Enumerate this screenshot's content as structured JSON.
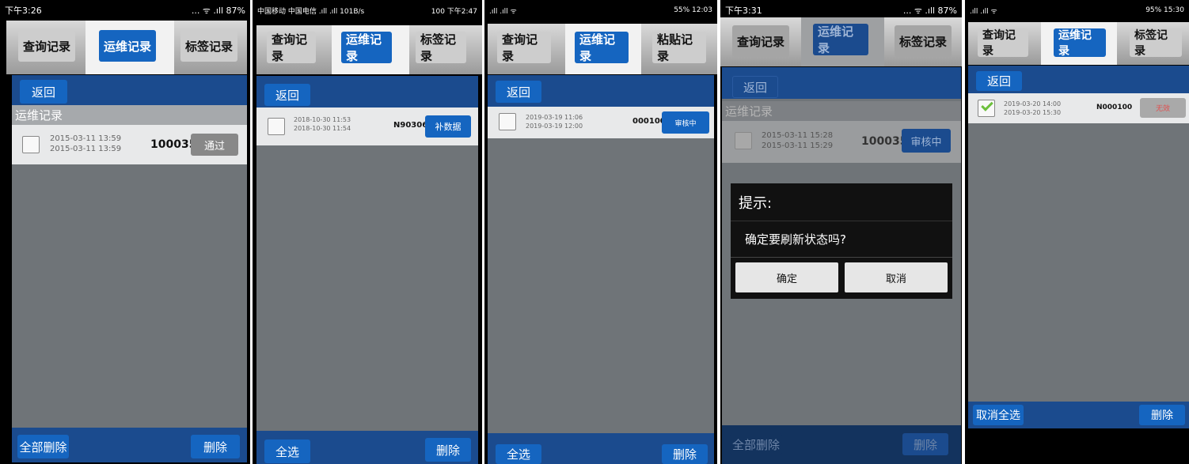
{
  "phones": [
    {
      "status_left": "下午3:26",
      "status_right": "... ᯤ .ıll 87%",
      "tabs": [
        "查询记录",
        "运维记录",
        "标签记录"
      ],
      "back": "返回",
      "section": "运维记录",
      "row": {
        "date1": "2015-03-11 13:59",
        "date2": "2015-03-11 13:59",
        "code": "100035",
        "status": "通过"
      },
      "bottom_left": "全部删除",
      "bottom_right": "删除"
    },
    {
      "status_left": "中国移动 中国电信 .ıll .ıll 101B/s",
      "status_right": "100 下午2:47",
      "tabs": [
        "查询记录",
        "运维记录",
        "标签记录"
      ],
      "back": "返回",
      "row": {
        "date1": "2018-10-30 11:53",
        "date2": "2018-10-30 11:54",
        "code": "N903069",
        "status": "补数据"
      },
      "bottom_left": "全选",
      "bottom_right": "删除"
    },
    {
      "status_left": ".ıll .ıll ᯤ",
      "status_right": "55% 12:03",
      "tabs": [
        "查询记录",
        "运维记录",
        "粘贴记录"
      ],
      "back": "返回",
      "row": {
        "date1": "2019-03-19 11:06",
        "date2": "2019-03-19 12:00",
        "code": "000100",
        "status": "审核中"
      },
      "bottom_left": "全选",
      "bottom_right": "删除"
    },
    {
      "status_left": "下午3:31",
      "status_right": "... ᯤ .ıll 87%",
      "tabs": [
        "查询记录",
        "运维记录",
        "标签记录"
      ],
      "back": "返回",
      "section": "运维记录",
      "row": {
        "date1": "2015-03-11 15:28",
        "date2": "2015-03-11 15:29",
        "code": "100035",
        "status": "审核中"
      },
      "dialog": {
        "title": "提示:",
        "message": "确定要刷新状态吗?",
        "ok": "确定",
        "cancel": "取消"
      },
      "bottom_left": "全部删除",
      "bottom_right": "删除"
    },
    {
      "status_left": ".ıll .ıll ᯤ",
      "status_right": "95% 15:30",
      "tabs": [
        "查询记录",
        "运维记录",
        "标签记录"
      ],
      "back": "返回",
      "row": {
        "date1": "2019-03-20 14:00",
        "date2": "2019-03-20 15:30",
        "code": "N000100",
        "status": "无效"
      },
      "bottom_left": "取消全选",
      "bottom_right": "删除"
    }
  ],
  "colors": {
    "accent": "#1565c0",
    "topbar": "#1b4b8e",
    "content": "#6f7478",
    "status_gray": "#888888",
    "invalid_text": "#e05050"
  }
}
